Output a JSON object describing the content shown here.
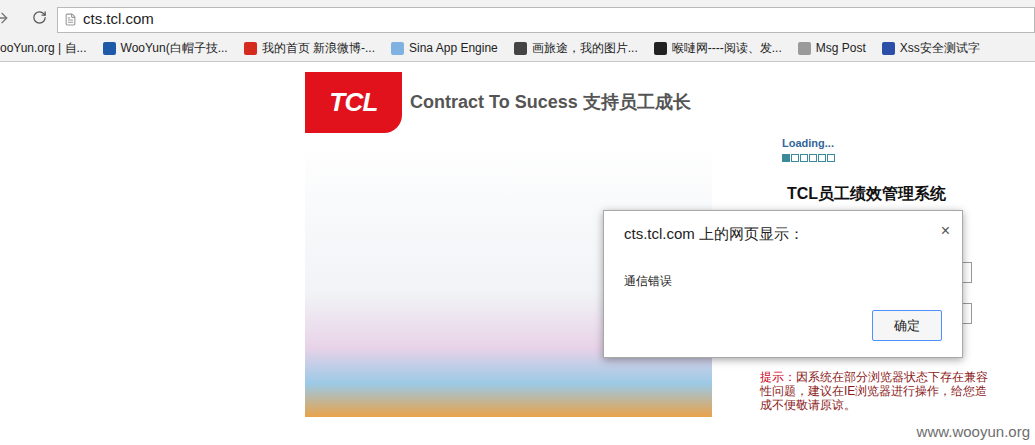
{
  "browser": {
    "url": "cts.tcl.com",
    "bookmarks": [
      {
        "label": "ooYun.org | 自...",
        "color": "#555555"
      },
      {
        "label": "WooYun(白帽子技...",
        "color": "#1e5aa8"
      },
      {
        "label": "我的首页 新浪微博-...",
        "color": "#d52b1e"
      },
      {
        "label": "Sina App Engine",
        "color": "#7fb2e0"
      },
      {
        "label": "画旅途，我的图片...",
        "color": "#444444"
      },
      {
        "label": "喉嗹网----阅读、发...",
        "color": "#222222"
      },
      {
        "label": "Msg Post",
        "color": "#9a9a9a"
      },
      {
        "label": "Xss安全测试字",
        "color": "#2b4fa8"
      }
    ]
  },
  "page": {
    "logo": "TCL",
    "slogan": "Contract To Sucess 支持员工成长",
    "loading": {
      "text": "Loading...",
      "blocks": [
        {
          "filled": true
        },
        {
          "filled": false
        },
        {
          "filled": false
        },
        {
          "filled": false
        },
        {
          "filled": false
        },
        {
          "filled": false
        }
      ]
    },
    "system_title": "TCL员工绩效管理系统",
    "hint": {
      "label": "提示：",
      "text": "因系统在部分浏览器状态下存在兼容性问题，建议在IE浏览器进行操作，给您造成不便敬请原谅。"
    }
  },
  "dialog": {
    "title": "cts.tcl.com 上的网页显示：",
    "close": "×",
    "message": "通信错误",
    "buttons": [
      "确定"
    ]
  },
  "watermark": "www.wooyun.org"
}
